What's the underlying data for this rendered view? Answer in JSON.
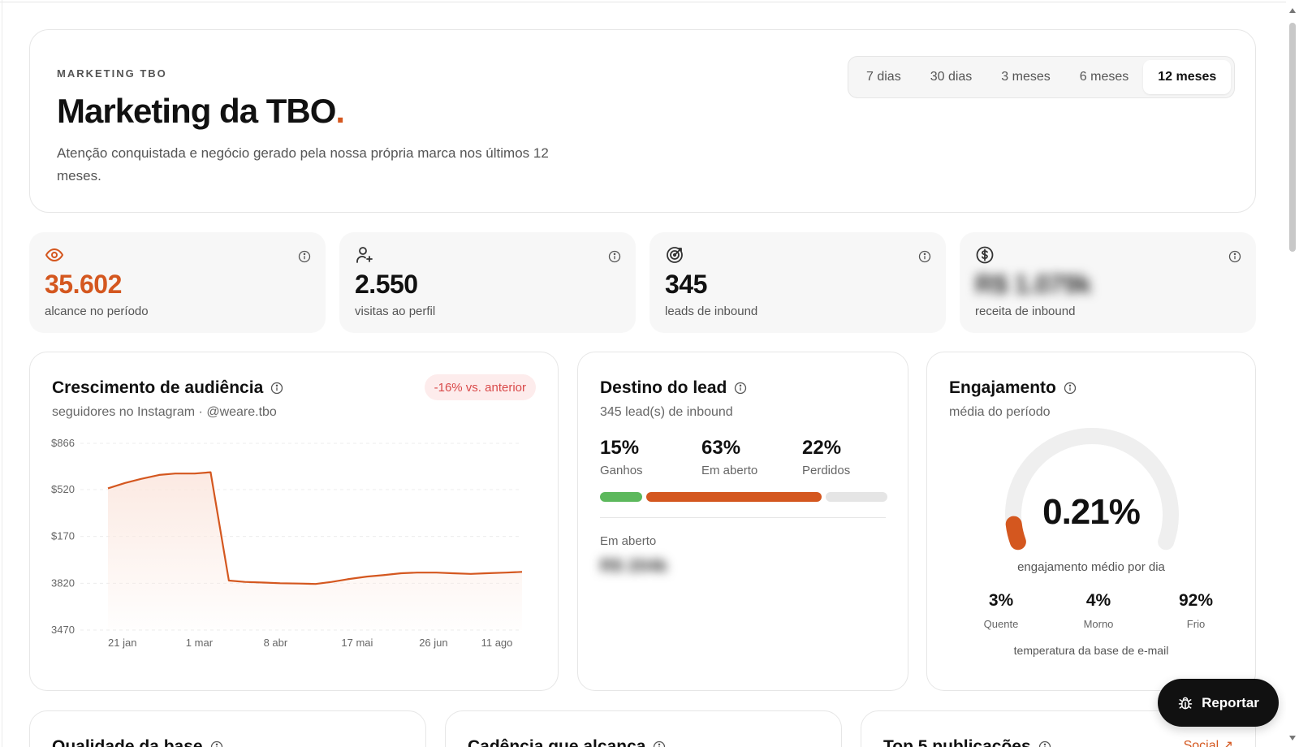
{
  "header": {
    "eyebrow": "MARKETING TBO",
    "title": "Marketing da TBO",
    "title_dot": ".",
    "subtitle": "Atenção conquistada e negócio gerado pela nossa própria marca nos últimos 12 meses.",
    "periods": [
      "7 dias",
      "30 dias",
      "3 meses",
      "6 meses",
      "12 meses"
    ],
    "active_period": "12 meses"
  },
  "kpis": [
    {
      "icon": "eye-icon",
      "value": "35.602",
      "label": "alcance no período",
      "accent": true
    },
    {
      "icon": "user-plus-icon",
      "value": "2.550",
      "label": "visitas ao perfil"
    },
    {
      "icon": "target-icon",
      "value": "345",
      "label": "leads de inbound"
    },
    {
      "icon": "dollar-icon",
      "value": "R$ 1.079k",
      "label": "receita de inbound",
      "blurred": true
    }
  ],
  "audience": {
    "title": "Crescimento de audiência",
    "subtitle": "seguidores no Instagram · @weare.tbo",
    "badge": "-16% vs. anterior"
  },
  "chart_data": {
    "type": "area",
    "title": "Crescimento de audiência",
    "xlabel": "",
    "ylabel": "",
    "y_tick_labels": [
      "$866",
      "$520",
      "$170",
      "3820",
      "3470"
    ],
    "y_tick_values": [
      4866,
      4520,
      4170,
      3820,
      3470
    ],
    "x_tick_labels": [
      "21 jan",
      "1 mar",
      "8 abr",
      "17 mai",
      "26 jun",
      "11 ago"
    ],
    "ylim": [
      3470,
      4866
    ],
    "grid": true,
    "legend": "none",
    "series": [
      {
        "x": [
          "2024-08-17",
          "2024-09-01",
          "2024-09-15",
          "2024-10-01",
          "2024-10-15",
          "2024-11-01",
          "2024-11-15",
          "2024-12-01",
          "2024-12-15",
          "2025-01-01",
          "2025-01-15",
          "2025-02-01",
          "2025-02-15",
          "2025-03-01",
          "2025-03-15",
          "2025-04-01",
          "2025-04-15",
          "2025-05-01",
          "2025-05-15",
          "2025-06-01",
          "2025-06-15",
          "2025-07-01",
          "2025-07-15",
          "2025-08-01",
          "2025-08-15"
        ],
        "values": [
          4530,
          4570,
          4600,
          4630,
          4640,
          4640,
          4650,
          3840,
          3830,
          3825,
          3820,
          3818,
          3815,
          3830,
          3850,
          3870,
          3880,
          3895,
          3900,
          3900,
          3895,
          3890,
          3895,
          3900,
          3905
        ]
      }
    ],
    "colors": {
      "line": "#d4571f",
      "fill": "#fbe7df"
    }
  },
  "lead": {
    "title": "Destino do lead",
    "subtitle": "345 lead(s) de inbound",
    "stats": [
      {
        "pct": "15%",
        "label": "Ganhos",
        "share": 0.15,
        "color": "#5cb85c"
      },
      {
        "pct": "63%",
        "label": "Em aberto",
        "share": 0.63,
        "color": "#d4571f"
      },
      {
        "pct": "22%",
        "label": "Perdidos",
        "share": 0.22,
        "color": "#e5e5e5"
      }
    ],
    "open_label": "Em aberto",
    "open_value": "R$ 204k"
  },
  "engagement": {
    "title": "Engajamento",
    "subtitle": "média do período",
    "value": "0.21%",
    "gauge_fraction": 0.06,
    "caption": "engajamento médio por dia",
    "temps": [
      {
        "pct": "3%",
        "label": "Quente"
      },
      {
        "pct": "4%",
        "label": "Morno"
      },
      {
        "pct": "92%",
        "label": "Frio"
      }
    ],
    "temps_caption": "temperatura da base de e-mail"
  },
  "bottom_cards": {
    "quality": "Qualidade da base",
    "cadence": "Cadência que alcança",
    "top5": "Top 5 publicações",
    "social_link": "Social ↗"
  },
  "report_button": "Reportar",
  "colors": {
    "accent": "#d4571f",
    "badge_bg": "#fdecec",
    "badge_text": "#d94a4a"
  }
}
